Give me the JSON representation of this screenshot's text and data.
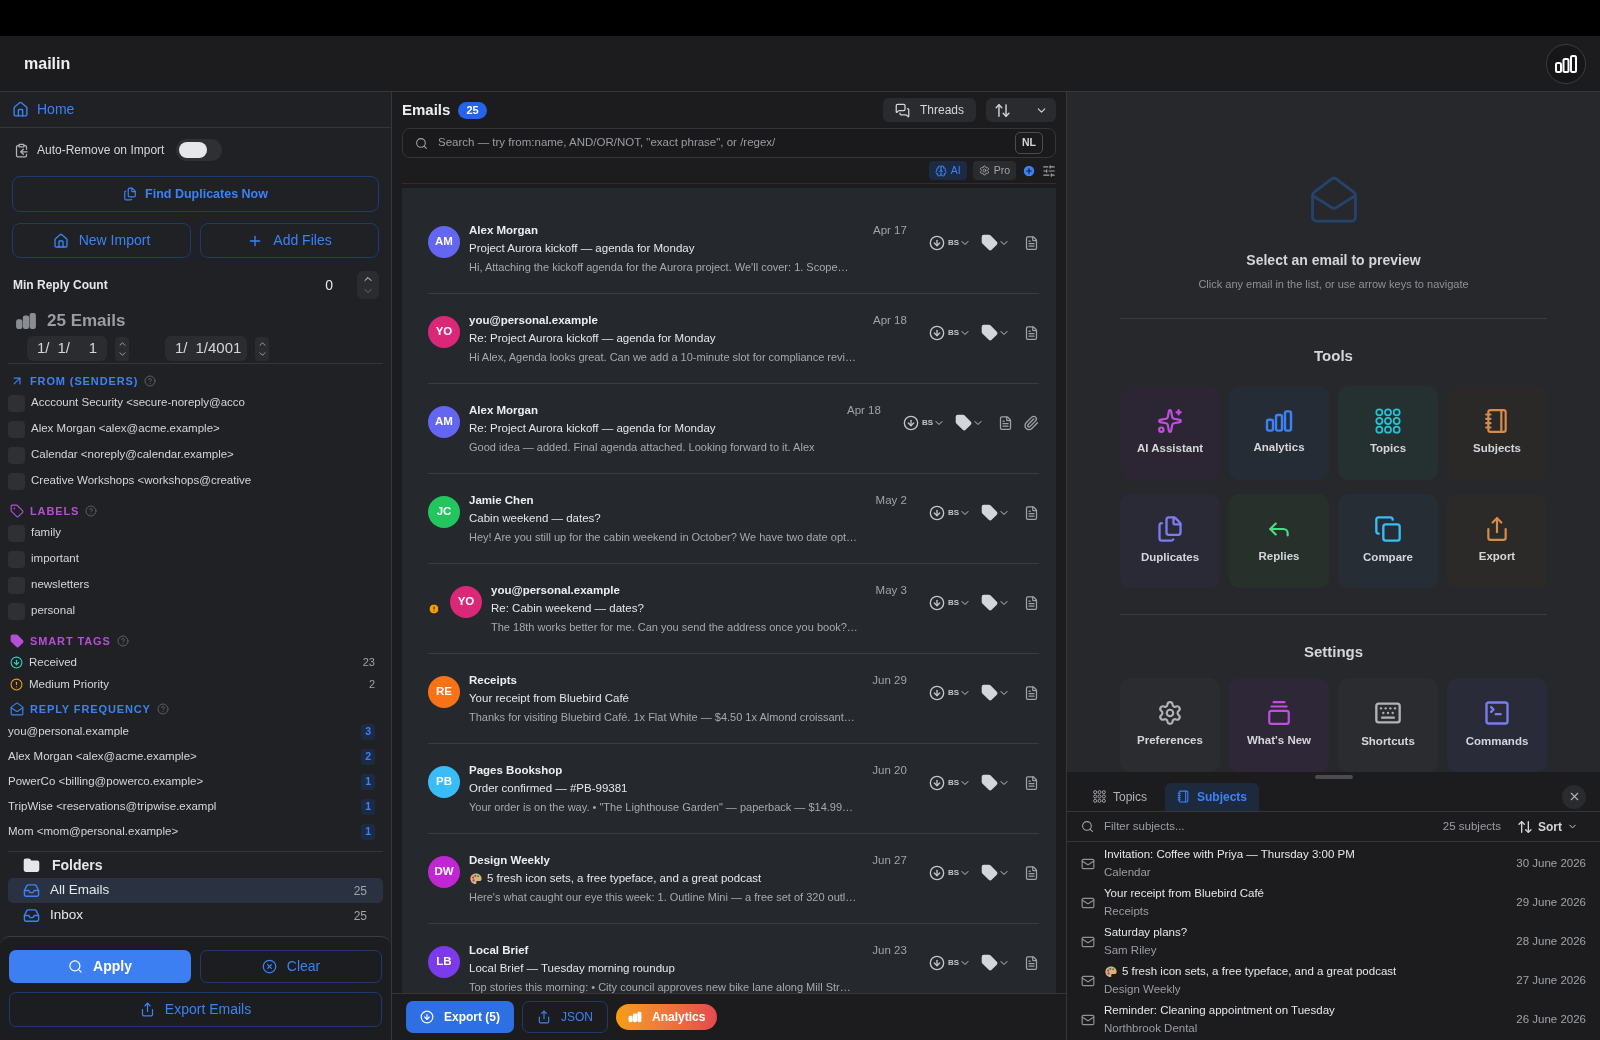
{
  "app": {
    "title": "mailin"
  },
  "sidebar": {
    "home": "Home",
    "auto_remove": {
      "label": "Auto-Remove on Import",
      "on": false
    },
    "find_duplicates": "Find Duplicates Now",
    "new_import": "New Import",
    "add_files": "Add Files",
    "min_reply": {
      "label": "Min Reply Count",
      "value": "0"
    },
    "email_count": "25 Emails",
    "date_from": [
      "1/",
      "1/",
      "1"
    ],
    "date_to": [
      "1/",
      "1/4001"
    ],
    "sections": [
      {
        "kind": "senders",
        "title": "FROM (SENDERS)",
        "items": [
          {
            "label": "Acccount Security <secure-noreply@acco",
            "checked": false
          },
          {
            "label": "Alex Morgan <alex@acme.example>",
            "checked": false
          },
          {
            "label": "Calendar <noreply@calendar.example>",
            "checked": false
          },
          {
            "label": "Creative Workshops <workshops@creative",
            "checked": false
          }
        ]
      },
      {
        "kind": "labels",
        "title": "LABELS",
        "items": [
          {
            "label": "family",
            "checked": false
          },
          {
            "label": "important",
            "checked": false
          },
          {
            "label": "newsletters",
            "checked": false
          },
          {
            "label": "personal",
            "checked": false
          }
        ]
      },
      {
        "kind": "smart_tags",
        "title": "SMART TAGS",
        "items": [
          {
            "kind": "received",
            "label": "Received",
            "count": "23"
          },
          {
            "kind": "priority",
            "label": "Medium Priority",
            "count": "2"
          }
        ]
      },
      {
        "kind": "reply_frequency",
        "title": "REPLY FREQUENCY",
        "items": [
          {
            "label": "you@personal.example",
            "count": "3"
          },
          {
            "label": "Alex Morgan <alex@acme.example>",
            "count": "2"
          },
          {
            "label": "PowerCo <billing@powerco.example>",
            "count": "1"
          },
          {
            "label": "TripWise <reservations@tripwise.exampl",
            "count": "1"
          },
          {
            "label": "Mom <mom@personal.example>",
            "count": "1"
          }
        ]
      }
    ],
    "folders": {
      "title": "Folders",
      "items": [
        {
          "label": "All Emails",
          "count": "25",
          "selected": true
        },
        {
          "label": "Inbox",
          "count": "25",
          "selected": false
        }
      ]
    },
    "apply": "Apply",
    "clear": "Clear",
    "export": "Export Emails"
  },
  "emails": {
    "title": "Emails",
    "count": "25",
    "threads": "Threads",
    "search_placeholder": "Search — try from:name, AND/OR/NOT, \"exact phrase\", or /regex/",
    "nl": "NL",
    "chips": [
      {
        "kind": "ai",
        "label": "AI"
      },
      {
        "kind": "pro",
        "label": "Pro"
      }
    ],
    "items": [
      {
        "initials": "AM",
        "color": "#6366f1",
        "sender": "Alex Morgan",
        "date": "Apr 17",
        "subject": "Project Aurora kickoff — agenda for Monday",
        "preview": "Hi,  Attaching the kickoff agenda for the Aurora project. We'll cover:  1. Scope…",
        "tag": "BS",
        "priority": false,
        "attachment": false,
        "emoji": false
      },
      {
        "initials": "YO",
        "color": "#db2777",
        "sender": "you@personal.example",
        "date": "Apr 18",
        "subject": "Re: Project Aurora kickoff — agenda for Monday",
        "preview": "Hi Alex,  Agenda looks great. Can we add a 10-minute slot for compliance revi…",
        "tag": "BS",
        "priority": false,
        "attachment": false,
        "emoji": false
      },
      {
        "initials": "AM",
        "color": "#6366f1",
        "sender": "Alex Morgan",
        "date": "Apr 18",
        "subject": "Re: Project Aurora kickoff — agenda for Monday",
        "preview": "Good idea — added. Final agenda attached. Looking forward to it.  Alex",
        "tag": "BS",
        "priority": false,
        "attachment": true,
        "emoji": false
      },
      {
        "initials": "JC",
        "color": "#22c55e",
        "sender": "Jamie Chen",
        "date": "May 2",
        "subject": "Cabin weekend — dates?",
        "preview": "Hey! Are you still up for the cabin weekend in October? We have two date opt…",
        "tag": "BS",
        "priority": false,
        "attachment": false,
        "emoji": false
      },
      {
        "initials": "YO",
        "color": "#db2777",
        "sender": "you@personal.example",
        "date": "May 3",
        "subject": "Re: Cabin weekend — dates?",
        "preview": "The 18th works better for me. Can you send the address once you book?…",
        "tag": "BS",
        "priority": true,
        "attachment": false,
        "emoji": false
      },
      {
        "initials": "RE",
        "color": "#f97316",
        "sender": "Receipts",
        "date": "Jun 29",
        "subject": "Your receipt from Bluebird Café",
        "preview": "Thanks for visiting Bluebird Café.  1x Flat White — $4.50 1x Almond croissant…",
        "tag": "BS",
        "priority": false,
        "attachment": false,
        "emoji": false
      },
      {
        "initials": "PB",
        "color": "#38bdf8",
        "sender": "Pages Bookshop",
        "date": "Jun 20",
        "subject": "Order confirmed — #PB-99381",
        "preview": "Your order is on the way.  • \"The Lighthouse Garden\" — paperback — $14.99…",
        "tag": "BS",
        "priority": false,
        "attachment": false,
        "emoji": false
      },
      {
        "initials": "DW",
        "color": "#c026d3",
        "sender": "Design Weekly",
        "date": "Jun 27",
        "subject": "5 fresh icon sets, a free typeface, and a great podcast",
        "preview": "Here's what caught our eye this week:  1. Outline Mini — a free set of 320 outl…",
        "tag": "BS",
        "priority": false,
        "attachment": false,
        "emoji": true
      },
      {
        "initials": "LB",
        "color": "#7c3aed",
        "sender": "Local Brief",
        "date": "Jun 23",
        "subject": "Local Brief — Tuesday morning roundup",
        "preview": "Top stories this morning:  • City council approves new bike lane along Mill Str…",
        "tag": "BS",
        "priority": false,
        "attachment": false,
        "emoji": false
      }
    ],
    "footer": {
      "export": "Export (5)",
      "json": "JSON",
      "analytics": "Analytics"
    }
  },
  "preview": {
    "title": "Select an email to preview",
    "hint": "Click any email in the list, or use arrow keys to navigate",
    "tools_title": "Tools",
    "tools": [
      {
        "kind": "ai",
        "label": "AI Assistant"
      },
      {
        "kind": "analytics",
        "label": "Analytics"
      },
      {
        "kind": "topics",
        "label": "Topics"
      },
      {
        "kind": "subjects",
        "label": "Subjects"
      },
      {
        "kind": "duplicates",
        "label": "Duplicates"
      },
      {
        "kind": "replies",
        "label": "Replies"
      },
      {
        "kind": "compare",
        "label": "Compare"
      },
      {
        "kind": "export",
        "label": "Export"
      }
    ],
    "settings_title": "Settings",
    "settings": [
      {
        "kind": "preferences",
        "label": "Preferences"
      },
      {
        "kind": "whats_new",
        "label": "What's New"
      },
      {
        "kind": "shortcuts",
        "label": "Shortcuts"
      },
      {
        "kind": "commands",
        "label": "Commands"
      }
    ]
  },
  "subjects_panel": {
    "tabs": [
      {
        "kind": "topics",
        "label": "Topics",
        "selected": false
      },
      {
        "kind": "subjects",
        "label": "Subjects",
        "selected": true
      }
    ],
    "filter_placeholder": "Filter subjects...",
    "count": "25 subjects",
    "sort": "Sort",
    "items": [
      {
        "subject": "Invitation: Coffee with Priya — Thursday 3:00 PM",
        "sender": "Calendar",
        "date": "30 June 2026",
        "emoji": false
      },
      {
        "subject": "Your receipt from Bluebird Café",
        "sender": "Receipts",
        "date": "29 June 2026",
        "emoji": false
      },
      {
        "subject": "Saturday plans?",
        "sender": "Sam Riley",
        "date": "28 June 2026",
        "emoji": false
      },
      {
        "subject": "5 fresh icon sets, a free typeface, and a great podcast",
        "sender": "Design Weekly",
        "date": "27 June 2026",
        "emoji": true
      },
      {
        "subject": "Reminder: Cleaning appointment on Tuesday",
        "sender": "Northbrook Dental",
        "date": "26 June 2026",
        "emoji": false
      }
    ]
  }
}
